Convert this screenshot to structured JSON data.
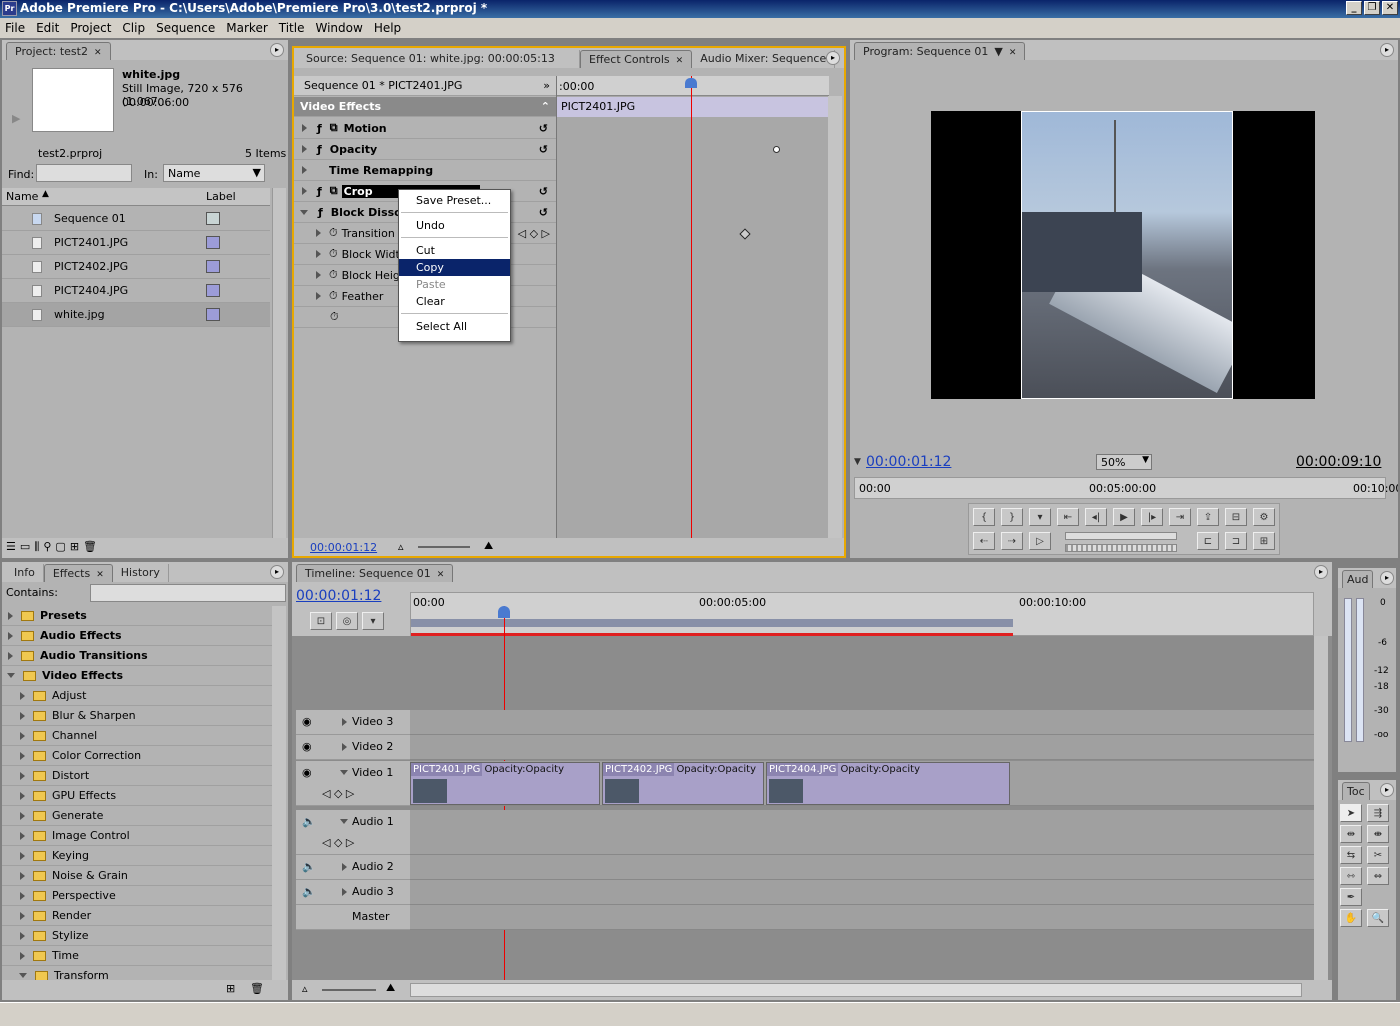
{
  "app": {
    "title": "Adobe Premiere Pro - C:\\Users\\Adobe\\Premiere Pro\\3.0\\test2.prproj *",
    "icon_label": "Pr"
  },
  "menu": [
    "File",
    "Edit",
    "Project",
    "Clip",
    "Sequence",
    "Marker",
    "Title",
    "Window",
    "Help"
  ],
  "project": {
    "tab": "Project: test2",
    "clip_name": "white.jpg",
    "clip_info1": "Still Image, 720 x 576 (1.067...",
    "clip_info2": "00:00:06:00",
    "file": "test2.prproj",
    "items": "5 Items",
    "find_label": "Find:",
    "in_label": "In:",
    "in_value": "Name",
    "col_name": "Name",
    "col_label": "Label",
    "rows": [
      {
        "name": "Sequence 01",
        "color": "#c8d4d4"
      },
      {
        "name": "PICT2401.JPG",
        "color": "#9c9cd8"
      },
      {
        "name": "PICT2402.JPG",
        "color": "#9c9cd8"
      },
      {
        "name": "PICT2404.JPG",
        "color": "#9c9cd8"
      },
      {
        "name": "white.jpg",
        "color": "#9c9cd8"
      }
    ]
  },
  "source_tabs": {
    "source": "Source: Sequence 01: white.jpg: 00:00:05:13",
    "effect_controls": "Effect Controls",
    "audio_mixer": "Audio Mixer: Sequence"
  },
  "effect_controls": {
    "header": "Sequence 01 * PICT2401.JPG",
    "section": "Video Effects",
    "clip_label": "PICT2401.JPG",
    "ruler_start": ":00:00",
    "effects": [
      "Motion",
      "Opacity",
      "Time Remapping",
      "Crop",
      "Block Dissol"
    ],
    "params": [
      "Transition",
      "Block Width",
      "Block Heigh",
      "Feather"
    ],
    "timecode": "00:00:01:12"
  },
  "context_menu": {
    "items": [
      "Save Preset...",
      "Undo",
      "Cut",
      "Copy",
      "Paste",
      "Clear",
      "Select All"
    ]
  },
  "program": {
    "tab": "Program: Sequence 01",
    "timecode": "00:00:01:12",
    "zoom": "50%",
    "duration": "00:00:09:10",
    "ruler": [
      "00:00",
      "00:05:00:00",
      "00:10:00"
    ]
  },
  "effects_panel": {
    "tabs": [
      "Info",
      "Effects",
      "History"
    ],
    "contains_label": "Contains:",
    "top_folders": [
      "Presets",
      "Audio Effects",
      "Audio Transitions",
      "Video Effects"
    ],
    "sub_folders": [
      "Adjust",
      "Blur & Sharpen",
      "Channel",
      "Color Correction",
      "Distort",
      "GPU Effects",
      "Generate",
      "Image Control",
      "Keying",
      "Noise & Grain",
      "Perspective",
      "Render",
      "Stylize",
      "Time",
      "Transform"
    ]
  },
  "timeline": {
    "tab": "Timeline: Sequence 01",
    "timecode": "00:00:01:12",
    "ruler": [
      "00:00",
      "00:00:05:00",
      "00:00:10:00"
    ],
    "tracks": [
      "Video 3",
      "Video 2",
      "Video 1",
      "Audio 1",
      "Audio 2",
      "Audio 3",
      "Master"
    ],
    "clips": [
      {
        "name": "PICT2401.JPG",
        "opacity": "Opacity:Opacity"
      },
      {
        "name": "PICT2402.JPG",
        "opacity": "Opacity:Opacity"
      },
      {
        "name": "PICT2404.JPG",
        "opacity": "Opacity:Opacity"
      }
    ]
  },
  "audio_meter": {
    "tab": "Aud",
    "scale": [
      "0",
      "-6",
      "-12",
      "-18",
      "-30",
      "-oo"
    ]
  },
  "tools": {
    "tab": "Toc"
  }
}
